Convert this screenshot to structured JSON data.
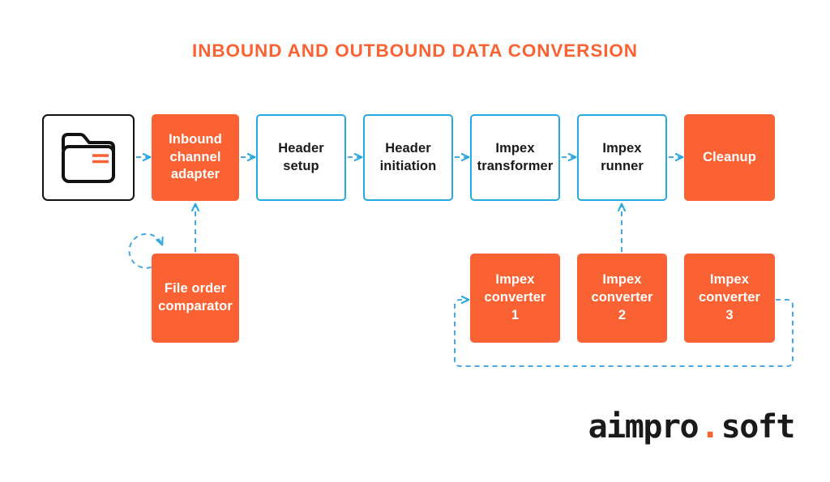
{
  "page": {
    "title": "INBOUND AND OUTBOUND DATA CONVERSION",
    "background_color": "#ffffff",
    "accent_orange": "#fa6233",
    "accent_blue": "#24a9e1",
    "outline_black": "#111111"
  },
  "nodes": {
    "source_folder": {
      "label": "",
      "icon": "folder-icon",
      "style": "plain-outline"
    },
    "inbound_channel_adapter": {
      "label": "Inbound\nchannel\nadapter",
      "style": "solid-orange"
    },
    "header_setup": {
      "label": "Header\nsetup",
      "style": "outline-blue"
    },
    "header_initiation": {
      "label": "Header\ninitiation",
      "style": "outline-blue"
    },
    "impex_transformer": {
      "label": "Impex\ntransformer",
      "style": "outline-blue"
    },
    "impex_runner": {
      "label": "Impex\nrunner",
      "style": "outline-blue"
    },
    "cleanup": {
      "label": "Cleanup",
      "style": "solid-orange"
    },
    "file_order_comparator": {
      "label": "File order\ncomparator",
      "style": "solid-orange"
    },
    "impex_converter_1": {
      "label": "Impex\nconverter\n1",
      "style": "solid-orange"
    },
    "impex_converter_2": {
      "label": "Impex\nconverter\n2",
      "style": "solid-orange"
    },
    "impex_converter_3": {
      "label": "Impex\nconverter\n3",
      "style": "solid-orange"
    }
  },
  "connectors": [
    {
      "name": "folder-to-inbound-adapter",
      "style": "dashed-arrow",
      "direction": "right"
    },
    {
      "name": "inbound-adapter-to-header-setup",
      "style": "dashed-arrow",
      "direction": "right"
    },
    {
      "name": "header-setup-to-header-initiation",
      "style": "dashed-arrow",
      "direction": "right"
    },
    {
      "name": "header-initiation-to-impex-transformer",
      "style": "dashed-arrow",
      "direction": "right"
    },
    {
      "name": "impex-transformer-to-impex-runner",
      "style": "dashed-arrow",
      "direction": "right"
    },
    {
      "name": "impex-runner-to-cleanup",
      "style": "dashed-arrow",
      "direction": "right"
    },
    {
      "name": "file-order-comparator-to-inbound-adapter",
      "style": "dashed-arrow",
      "direction": "up"
    },
    {
      "name": "file-order-comparator-self-loop",
      "style": "dashed-circular-arrow",
      "direction": "loop"
    },
    {
      "name": "impex-converter-2-to-impex-runner",
      "style": "dashed-arrow",
      "direction": "up"
    },
    {
      "name": "impex-converters-feedback-loop",
      "style": "dashed-arrow",
      "direction": "loop-left"
    }
  ],
  "logo": {
    "name": "aimpro",
    "dot": ".",
    "suffix": "soft"
  }
}
